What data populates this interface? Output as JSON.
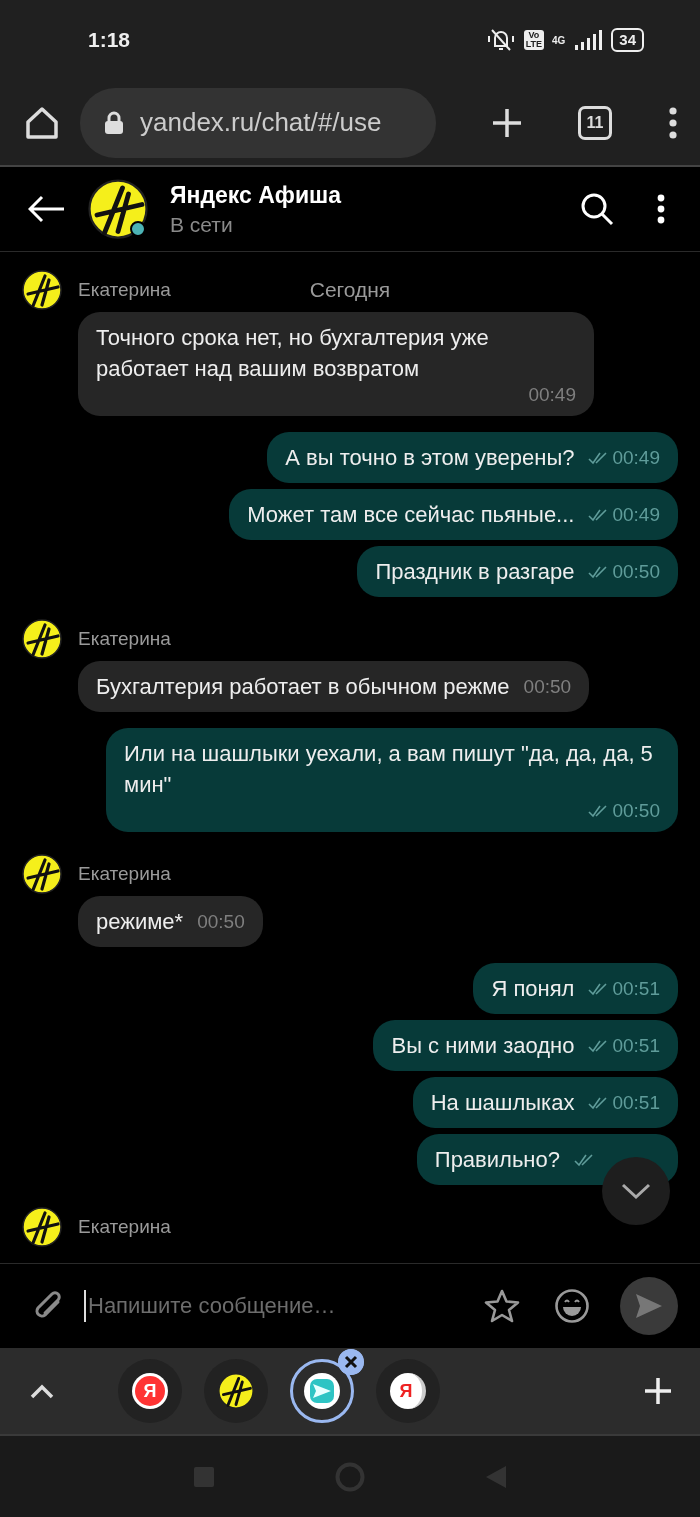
{
  "status_bar": {
    "time": "1:18",
    "volte_top": "Vo",
    "volte_bottom": "LTE",
    "network": "4G",
    "battery": "34"
  },
  "browser": {
    "url": "yandex.ru/chat/#/use",
    "tab_count": "11"
  },
  "chat": {
    "title": "Яндекс Афиша",
    "status": "В сети",
    "online": true
  },
  "date_label": "Сегодня",
  "messages": [
    {
      "kind": "incoming",
      "sender": "Екатерина",
      "text": "Точного срока нет, но бухгалтерия уже работает над вашим возвратом",
      "time": "00:49"
    },
    {
      "kind": "outgoing",
      "text": "А вы точно в этом уверены?",
      "time": "00:49",
      "read": true
    },
    {
      "kind": "outgoing",
      "text": "Может там все сейчас пьяные...",
      "time": "00:49",
      "read": true
    },
    {
      "kind": "outgoing",
      "text": "Праздник в разгаре",
      "time": "00:50",
      "read": true
    },
    {
      "kind": "incoming",
      "sender": "Екатерина",
      "text": "Бухгалтерия работает в обычном режме",
      "time": "00:50"
    },
    {
      "kind": "outgoing",
      "text": "Или на шашлыки уехали, а вам пишут \"да, да, да, 5 мин\"",
      "time": "00:50",
      "read": true
    },
    {
      "kind": "incoming",
      "sender": "Екатерина",
      "text": "режиме*",
      "time": "00:50"
    },
    {
      "kind": "outgoing",
      "text": "Я понял",
      "time": "00:51",
      "read": true
    },
    {
      "kind": "outgoing",
      "text": "Вы с ними заодно",
      "time": "00:51",
      "read": true
    },
    {
      "kind": "outgoing",
      "text": "На шашлыках",
      "time": "00:51",
      "read": true
    },
    {
      "kind": "outgoing",
      "text": "Правильно?",
      "read": true
    },
    {
      "kind": "incoming",
      "sender": "Екатерина"
    }
  ],
  "composer": {
    "placeholder": "Напишите сообщение…"
  },
  "tabs": [
    {
      "kind": "yandex",
      "letter": "Я",
      "selected": false
    },
    {
      "kind": "afisha",
      "selected": false
    },
    {
      "kind": "messenger",
      "selected": true
    },
    {
      "kind": "browser",
      "letter": "Я",
      "selected": false
    }
  ]
}
